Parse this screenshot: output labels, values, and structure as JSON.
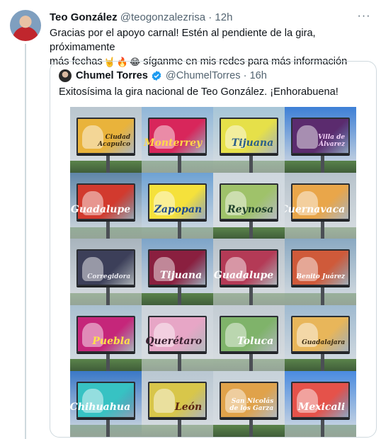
{
  "tweet": {
    "author_name": "Teo González",
    "author_handle": "@teogonzalezrisa",
    "time": "12h",
    "text_line1": "Gracias por el apoyo carnal! Estén al pendiente de la gira, próximamente",
    "text_line2_a": "más fechas",
    "text_line2_b": "síganme en mis redes para más información",
    "emojis": [
      "🤘",
      "🔥",
      "😂"
    ],
    "more_icon": "more-horizontal-icon"
  },
  "quoted": {
    "author_name": "Chumel Torres",
    "author_handle": "@ChumelTorres",
    "time": "16h",
    "verified_color": "#1d9bf0",
    "text": "Exitosísima la gira nacional de Teo González. ¡Enhorabuena!",
    "billboards": [
      {
        "city": "Ciudad Acapulco",
        "color": "#e9b33b",
        "text_color": "#3a2a10",
        "sky": "#b9c6cf"
      },
      {
        "city": "Monterrey",
        "color": "#d8265b",
        "text_color": "#ffd84a",
        "sky": "#8fb6d8"
      },
      {
        "city": "Tijuana",
        "color": "#e6e049",
        "text_color": "#2c5f8a",
        "sky": "#a7c5d7"
      },
      {
        "city": "Villa de Álvarez",
        "color": "#5b2b6e",
        "text_color": "#f2d0f7",
        "sky": "#3d7fd6"
      },
      {
        "city": "Guadalupe",
        "color": "#d23a2e",
        "text_color": "#ffffff",
        "sky": "#5f86a8"
      },
      {
        "city": "Zapopan",
        "color": "#f5e13b",
        "text_color": "#1e4a8f",
        "sky": "#6ea2d4"
      },
      {
        "city": "Reynosa",
        "color": "#9fc26a",
        "text_color": "#1e3f2a",
        "sky": "#cfd8df"
      },
      {
        "city": "Cuernavaca",
        "color": "#e9a64a",
        "text_color": "#ffffff",
        "sky": "#b7c3cc"
      },
      {
        "city": "Corregidora",
        "color": "#3c3f59",
        "text_color": "#e9e9ef",
        "sky": "#a8b4bd"
      },
      {
        "city": "Tijuana",
        "color": "#8a1f3f",
        "text_color": "#ffffff",
        "sky": "#7da4c9"
      },
      {
        "city": "Guadalupe",
        "color": "#b43a56",
        "text_color": "#ffffff",
        "sky": "#b8c2ca"
      },
      {
        "city": "Benito Juárez",
        "color": "#cf5a3a",
        "text_color": "#ffffff",
        "sky": "#8aa9c2"
      },
      {
        "city": "Puebla",
        "color": "#c5267a",
        "text_color": "#ffe24a",
        "sky": "#a9c0d0"
      },
      {
        "city": "Querétaro",
        "color": "#e7a6c6",
        "text_color": "#3a2030",
        "sky": "#cbd3da"
      },
      {
        "city": "Toluca",
        "color": "#7fb36a",
        "text_color": "#ffffff",
        "sky": "#c3ccd3"
      },
      {
        "city": "Guadalajara",
        "color": "#e8b65a",
        "text_color": "#3a2a10",
        "sky": "#9fbad0"
      },
      {
        "city": "Chihuahua",
        "color": "#37c2c3",
        "text_color": "#ffffff",
        "sky": "#3a78c7"
      },
      {
        "city": "León",
        "color": "#d8c64a",
        "text_color": "#5a2210",
        "sky": "#b9c7d2"
      },
      {
        "city": "San Nicolás de los Garza",
        "color": "#e0a24a",
        "text_color": "#ffffff",
        "sky": "#c7d2da"
      },
      {
        "city": "Mexicali",
        "color": "#e5524a",
        "text_color": "#ffffff",
        "sky": "#4a8be0"
      }
    ]
  }
}
